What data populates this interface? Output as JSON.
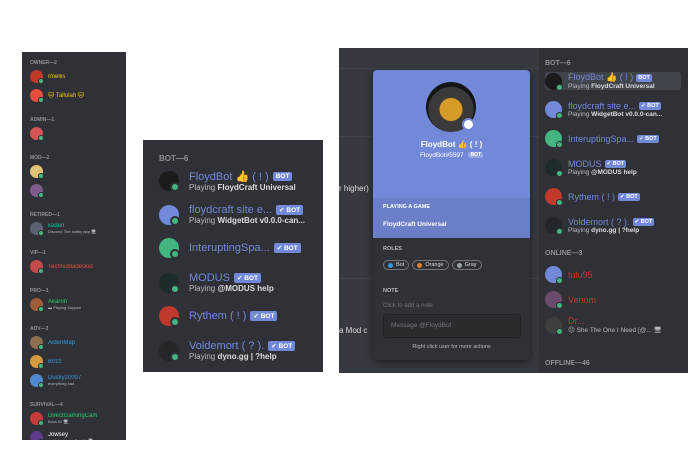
{
  "panel1": {
    "sections": [
      {
        "title": "OWNER—2",
        "members": [
          {
            "name": "rmellis",
            "status": "",
            "color": "#f1c40f",
            "av": "#c0392b"
          },
          {
            "name": "🐱 Tallulah 🐱",
            "status": "",
            "color": "#f1c40f",
            "av": "#e74c3c"
          }
        ]
      },
      {
        "title": "ADMIN—1",
        "members": [
          {
            "name": "",
            "status": "",
            "color": "#e91e63",
            "av": "#d35454"
          }
        ]
      },
      {
        "title": "MOD—2",
        "members": [
          {
            "name": "",
            "status": "",
            "color": "#e67e22",
            "av": "#e2c275"
          },
          {
            "name": "",
            "status": "",
            "color": "#9b59b6",
            "av": "#7d5c8a"
          }
        ]
      },
      {
        "title": "RETIRED—1",
        "members": [
          {
            "name": "kaden",
            "status": "Discord: The slothy app 🖥",
            "color": "#1abc9c",
            "av": "#5b6270"
          }
        ]
      },
      {
        "title": "VIP—1",
        "members": [
          {
            "name": "Technobladeskid",
            "status": "",
            "color": "#e74c3c",
            "av": "#c44b4b"
          }
        ]
      },
      {
        "title": "PRO—1",
        "members": [
          {
            "name": "Akarrin",
            "status": "▬ Playing Support",
            "color": "#2ecc71",
            "av": "#a05d38"
          }
        ]
      },
      {
        "title": "ADV—3",
        "members": [
          {
            "name": "AidenMap",
            "status": "",
            "color": "#3498db",
            "av": "#8b6f4e"
          },
          {
            "name": "B0zz",
            "status": "",
            "color": "#3498db",
            "av": "#d49a3d"
          },
          {
            "name": "Ducky20007",
            "status": "everything bad",
            "color": "#3498db",
            "av": "#4f8ad1"
          }
        ]
      },
      {
        "title": "SURVIVAL—4",
        "members": [
          {
            "name": "DirectGamingCam",
            "status": "Boss ID 🖥",
            "color": "#2ecc71",
            "av": "#c73a3a"
          },
          {
            "name": "Jowsey",
            "status": "▬ Listening to Spotify 🖥",
            "color": "#ffffff",
            "av": "#5b3b8a"
          }
        ]
      }
    ]
  },
  "panel2": {
    "title": "BOT—6",
    "bot_label": "✔ BOT",
    "bot_label_plain": "BOT",
    "members": [
      {
        "name": "FloydBot 👍 ( ! )",
        "status_prefix": "Playing ",
        "status": "FloydCraft Universal",
        "verified": false,
        "av": "#1b1b1b"
      },
      {
        "name": "floydcraft site e...",
        "status_prefix": "Playing ",
        "status": "WidgetBot v0.0.0-can...",
        "verified": true,
        "av": "#7289da"
      },
      {
        "name": "InteruptingSpa...",
        "status_prefix": "",
        "status": "",
        "verified": true,
        "av": "#43b581"
      },
      {
        "name": "MODUS",
        "status_prefix": "Playing ",
        "status": "@MODUS help",
        "verified": true,
        "av": "#1e2b2b"
      },
      {
        "name": "Rythem ( ! )",
        "status_prefix": "",
        "status": "",
        "verified": true,
        "av": "#c0392b"
      },
      {
        "name": "Voldemort ( ? ).",
        "status_prefix": "Playing ",
        "status": "dyno.gg | ?help",
        "verified": true,
        "av": "#23272a"
      }
    ]
  },
  "panel3": {
    "chat_fragments": [
      "r higher)",
      "a Mod c"
    ],
    "popup": {
      "name": "FloydBot 👍 ( ! )",
      "tag": "FloydBot#5597",
      "tag_badge": "BOT",
      "game_heading": "PLAYING A GAME",
      "game_name": "FloydCraft Universal",
      "roles_heading": "ROLES",
      "roles": [
        {
          "name": "Bot",
          "color": "#3498db"
        },
        {
          "name": "Orange",
          "color": "#e67e22"
        },
        {
          "name": "Gray",
          "color": "#95a5a6"
        }
      ],
      "note_heading": "NOTE",
      "note_placeholder": "Click to add a note",
      "message_placeholder": "Message @FloydBot",
      "footer": "Right click user for more actions"
    },
    "bot_section": "BOT—6",
    "online_section": "ONLINE—3",
    "offline_section": "OFFLINE—46",
    "bots": [
      {
        "name": "FloydBot 👍 ( ! )",
        "status_prefix": "Playing ",
        "status": "FloydCraft Universal",
        "badge": "BOT",
        "av": "#1b1b1b"
      },
      {
        "name": "floydcraft site e...",
        "status_prefix": "Playing ",
        "status": "WidgetBot v0.0.0-can...",
        "badge": "✔ BOT",
        "av": "#7289da"
      },
      {
        "name": "InteruptingSpa...",
        "status_prefix": "",
        "status": "",
        "badge": "✔ BOT",
        "av": "#43b581"
      },
      {
        "name": "MODUS",
        "status_prefix": "Playing ",
        "status": "@MODUS help",
        "badge": "✔ BOT",
        "av": "#1e2b2b"
      },
      {
        "name": "Rythem ( ! )",
        "status_prefix": "",
        "status": "",
        "badge": "✔ BOT",
        "av": "#c0392b"
      },
      {
        "name": "Voldemort ( ? ).",
        "status_prefix": "Playing ",
        "status": "dyno.gg | ?help",
        "badge": "✔ BOT",
        "av": "#23272a"
      }
    ],
    "online": [
      {
        "name": "tulu95",
        "status": "",
        "color": "#c0392b",
        "av": "#7289da"
      },
      {
        "name": "Venom",
        "status": "",
        "color": "#c0392b",
        "av": "#6b4b6b"
      },
      {
        "name": "Dr...",
        "status": "😐 She The One I Need [@... 🖥",
        "color": "#c0392b",
        "av": "#3e3e3e"
      }
    ]
  }
}
